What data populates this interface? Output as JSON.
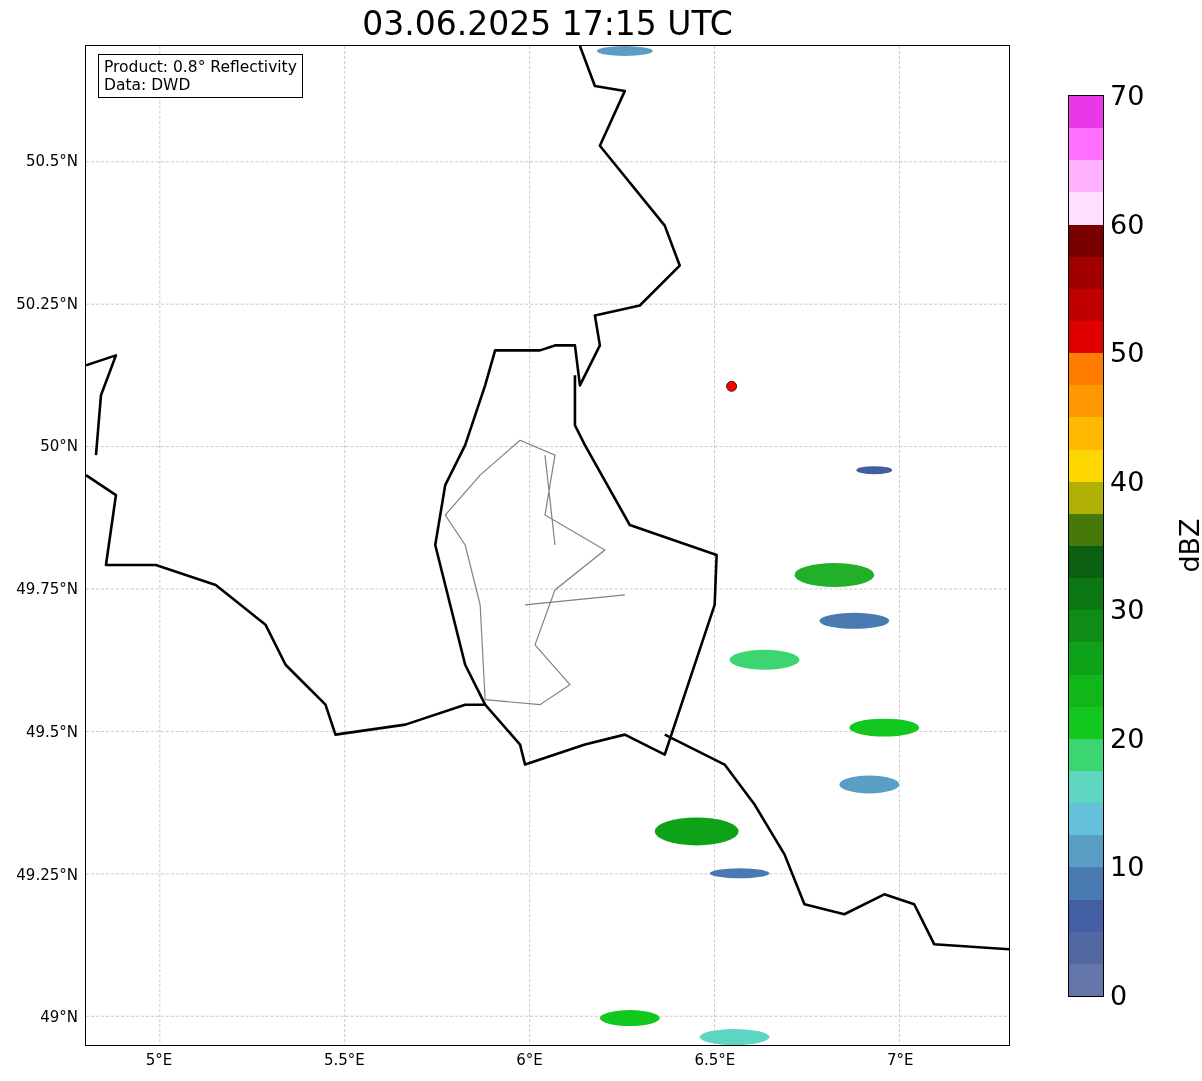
{
  "title": "03.06.2025 17:15 UTC",
  "info_box": [
    "Product: 0.8° Reflectivity",
    "Data: DWD"
  ],
  "map": {
    "x_ticks": [
      "5°E",
      "5.5°E",
      "6°E",
      "6.5°E",
      "7°E"
    ],
    "y_ticks": [
      "50.5°N",
      "50.25°N",
      "50°N",
      "49.75°N",
      "49.5°N",
      "49.25°N",
      "49°N"
    ]
  },
  "colorbar": {
    "label": "dBZ",
    "ticks": [
      "70",
      "60",
      "50",
      "40",
      "30",
      "20",
      "10",
      "0"
    ],
    "bands": [
      {
        "color": "#e838e8"
      },
      {
        "color": "#ff70ff"
      },
      {
        "color": "#ffb0ff"
      },
      {
        "color": "#ffe0ff"
      },
      {
        "color": "#7a0000"
      },
      {
        "color": "#a00000"
      },
      {
        "color": "#c00000"
      },
      {
        "color": "#e00000"
      },
      {
        "color": "#ff7c00"
      },
      {
        "color": "#ff9800"
      },
      {
        "color": "#ffb800"
      },
      {
        "color": "#ffd700"
      },
      {
        "color": "#b0b004"
      },
      {
        "color": "#46780a"
      },
      {
        "color": "#0a6010"
      },
      {
        "color": "#0c7814"
      },
      {
        "color": "#0e8c16"
      },
      {
        "color": "#0ea218"
      },
      {
        "color": "#10b61a"
      },
      {
        "color": "#12c81e"
      },
      {
        "color": "#3cd670"
      },
      {
        "color": "#5ed6c2"
      },
      {
        "color": "#66c2da"
      },
      {
        "color": "#5a9ec6"
      },
      {
        "color": "#4a7ab2"
      },
      {
        "color": "#445ea4"
      },
      {
        "color": "#5268a0"
      },
      {
        "color": "#6475a8"
      }
    ]
  }
}
